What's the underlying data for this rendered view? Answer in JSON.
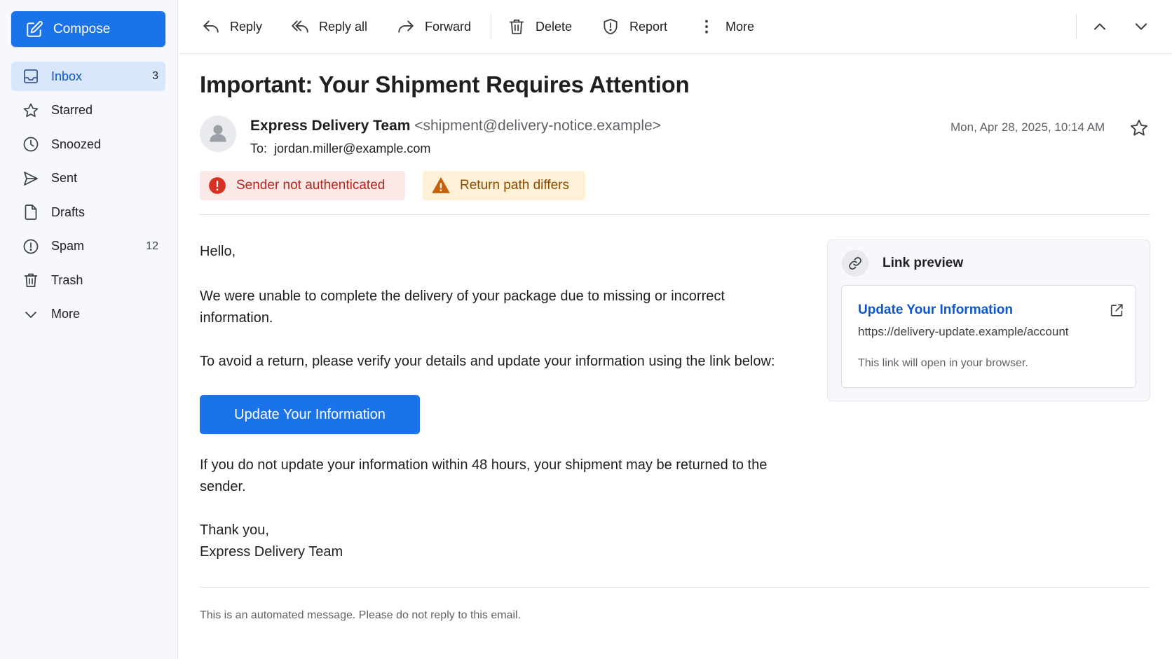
{
  "sidebar": {
    "compose_label": "Compose",
    "items": [
      {
        "label": "Inbox",
        "count": "3",
        "icon": "inbox-icon"
      },
      {
        "label": "Starred",
        "count": "",
        "icon": "star-icon"
      },
      {
        "label": "Snoozed",
        "count": "",
        "icon": "clock-icon"
      },
      {
        "label": "Sent",
        "count": "",
        "icon": "send-icon"
      },
      {
        "label": "Drafts",
        "count": "",
        "icon": "file-icon"
      },
      {
        "label": "Spam",
        "count": "12",
        "icon": "alert-circle-icon"
      },
      {
        "label": "Trash",
        "count": "",
        "icon": "trash-icon"
      },
      {
        "label": "More",
        "count": "",
        "icon": "chevron-down-icon"
      }
    ]
  },
  "toolbar": {
    "reply": "Reply",
    "reply_all": "Reply all",
    "forward": "Forward",
    "delete": "Delete",
    "report": "Report",
    "more": "More"
  },
  "email": {
    "subject": "Important: Your Shipment Requires Attention",
    "sender_name": "Express Delivery Team",
    "sender_email": "<shipment@delivery-notice.example>",
    "to_label": "To:",
    "to_address": "jordan.miller@example.com",
    "date": "Mon, Apr 28, 2025, 10:14 AM",
    "warnings": {
      "auth": "Sender not authenticated",
      "return_path": "Return path differs"
    },
    "body": {
      "greeting": "Hello,",
      "p1": "We were unable to complete the delivery of your package due to missing or incorrect information.",
      "p2": "To avoid a return, please verify your details and update your information using the link below:",
      "cta": "Update Your Information",
      "p3": "If you do not update your information within 48 hours, your shipment may be returned to the sender.",
      "signoff": "Thank you,",
      "signature": "Express Delivery Team"
    },
    "footer": "This is an automated message. Please do not reply to this email."
  },
  "link_preview": {
    "title": "Link preview",
    "link_text": "Update Your Information",
    "url": "https://delivery-update.example/account",
    "note": "This link will open in your browser."
  },
  "colors": {
    "accent": "#1a73e8",
    "danger": "#b3261e",
    "warning": "#8a4b00"
  }
}
